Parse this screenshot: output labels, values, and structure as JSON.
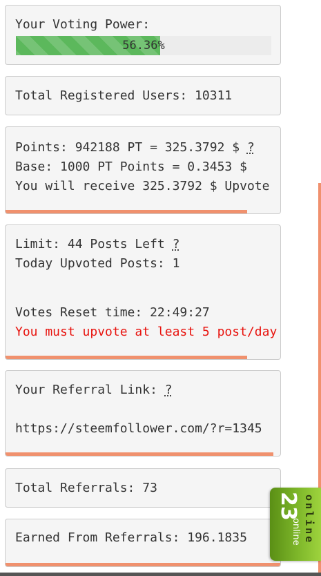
{
  "colors": {
    "accent": "#f0916e",
    "progress_green": "#5cb85c",
    "warning_red": "#e8140f",
    "widget_green": "#7eb72a"
  },
  "voting": {
    "label": "Your Voting Power:",
    "percent_text": "56.36%",
    "percent_value": 56.36
  },
  "users": {
    "label": "Total Registered Users: 10311"
  },
  "points": {
    "line1": "Points: 942188 PT = 325.3792 $",
    "line2": "Base: 1000 PT Points = 0.3453 $",
    "line3": "You will receive 325.3792 $ Upvote",
    "help": "?"
  },
  "limits": {
    "line1": "Limit: 44 Posts Left",
    "line2": "Today Upvoted Posts: 1",
    "line3": "Votes Reset time: 22:49:27",
    "warning": "You must upvote at least 5 post/day",
    "help": "?"
  },
  "referral": {
    "label": "Your Referral Link:",
    "help": "?",
    "link": "https://steemfollower.com/?r=1345"
  },
  "total_referrals": {
    "label": "Total Referrals: 73"
  },
  "earned": {
    "label": "Earned From Referrals: 196.1835"
  },
  "online_widget": {
    "count": "23",
    "label": "online",
    "label_vertical": "online"
  }
}
